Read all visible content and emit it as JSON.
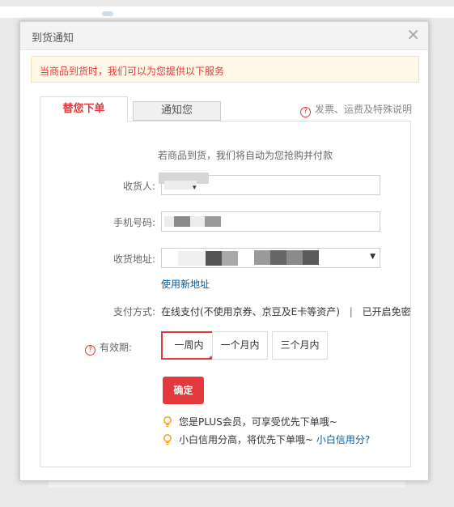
{
  "dialog": {
    "title": "到货通知",
    "notice": "当商品到货时，我们可以为您提供以下服务"
  },
  "tabs": {
    "active": "替您下单",
    "inactive": "通知您"
  },
  "help_link": "发票、运费及特殊说明",
  "form": {
    "intro": "若商品到货，我们将自动为您抢购并付款",
    "consignee_label": "收货人:",
    "phone_label": "手机号码:",
    "address_label": "收货地址:",
    "new_address": "使用新地址",
    "payment_label": "支付方式:",
    "payment_value": "在线支付(不使用京券、京豆及E卡等资产)",
    "payment_separator": "|",
    "payment_status": "已开启免密",
    "validity_label": "有效期:",
    "validity_options": [
      "一周内",
      "一个月内",
      "三个月内"
    ],
    "confirm": "确定"
  },
  "tips": {
    "tip1": "您是PLUS会员，可享受优先下单哦~",
    "tip2": "小白信用分高，将优先下单哦~",
    "tip2_link": "小白信用分?"
  },
  "colors": {
    "accent": "#e4393c",
    "link": "#005ea7",
    "bulb": "#f5a623"
  }
}
